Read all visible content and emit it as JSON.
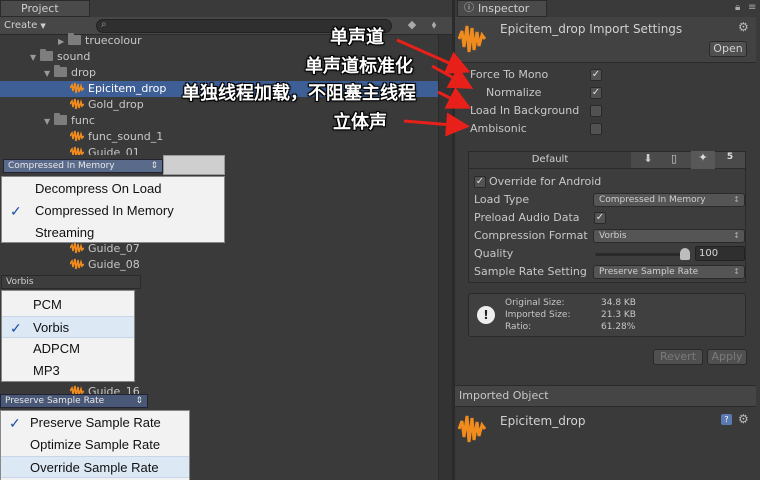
{
  "project": {
    "tab_label": "Project",
    "create_label": "Create",
    "tree": [
      {
        "label": "truecolour",
        "kind": "folder"
      },
      {
        "label": "sound",
        "kind": "folder"
      },
      {
        "label": "drop",
        "kind": "folder"
      },
      {
        "label": "Epicitem_drop",
        "kind": "audio"
      },
      {
        "label": "Gold_drop",
        "kind": "audio"
      },
      {
        "label": "func",
        "kind": "folder"
      },
      {
        "label": "func_sound_1",
        "kind": "audio"
      },
      {
        "label": "Guide_01",
        "kind": "audio"
      },
      {
        "label": "Guide_07",
        "kind": "audio"
      },
      {
        "label": "Guide_08",
        "kind": "audio"
      },
      {
        "label": "Guide_16",
        "kind": "audio"
      }
    ]
  },
  "dropdowns": {
    "load_type": {
      "header": "Compressed In Memory",
      "options": [
        "Decompress On Load",
        "Compressed In Memory",
        "Streaming"
      ],
      "selected": "Compressed In Memory"
    },
    "compression_format": {
      "header": "Vorbis",
      "options": [
        "PCM",
        "Vorbis",
        "ADPCM",
        "MP3"
      ],
      "selected": "Vorbis"
    },
    "sample_rate": {
      "header": "Preserve Sample Rate",
      "options": [
        "Preserve Sample Rate",
        "Optimize Sample Rate",
        "Override Sample Rate"
      ],
      "selected": "Preserve Sample Rate"
    }
  },
  "inspector": {
    "tab_label": "Inspector",
    "title": "Epicitem_drop Import Settings",
    "open_label": "Open",
    "props": [
      {
        "label": "Force To Mono",
        "checked": true
      },
      {
        "label": "Normalize",
        "checked": true
      },
      {
        "label": "Load In Background",
        "checked": false
      },
      {
        "label": "Ambisonic",
        "checked": false
      }
    ],
    "platform_default_label": "Default",
    "override_label": "Override for Android",
    "load_type_label": "Load Type",
    "load_type_value": "Compressed In Memory",
    "preload_label": "Preload Audio Data",
    "compression_label": "Compression Format",
    "compression_value": "Vorbis",
    "quality_label": "Quality",
    "quality_value": "100",
    "quality_fraction": 1.0,
    "sample_rate_label": "Sample Rate Setting",
    "sample_rate_value": "Preserve Sample Rate",
    "info": {
      "original_label": "Original Size:",
      "original_value": "34.8 KB",
      "imported_label": "Imported Size:",
      "imported_value": "21.3 KB",
      "ratio_label": "Ratio:",
      "ratio_value": "61.28%"
    },
    "revert_label": "Revert",
    "apply_label": "Apply",
    "imported_object_label": "Imported Object",
    "imported_object_name": "Epicitem_drop"
  },
  "annotations": {
    "mono": "单声道",
    "normalize": "单声道标准化",
    "background": "单独线程加载，不阻塞主线程",
    "ambisonic": "立体声"
  },
  "colors": {
    "annotation_arrow": "#e8201a",
    "selection": "#3e5f96",
    "audio_icon": "#f08c1e"
  }
}
